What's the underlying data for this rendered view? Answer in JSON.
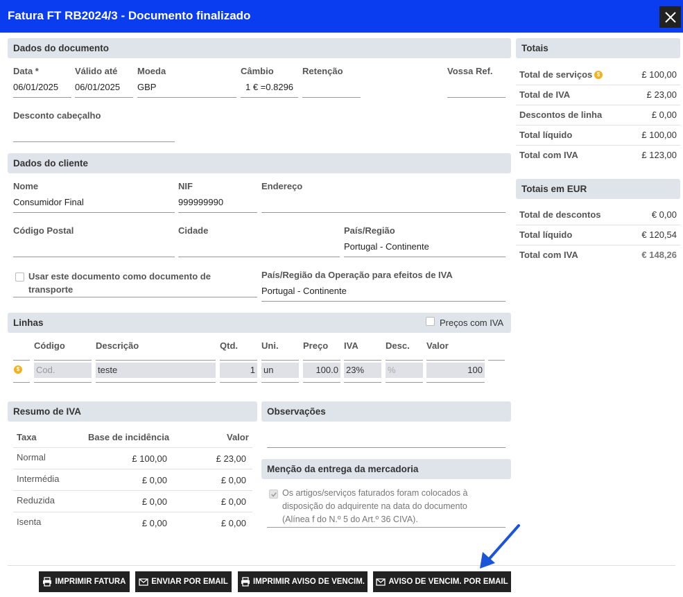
{
  "window": {
    "title": "Fatura FT RB2024/3 - Documento finalizado"
  },
  "document": {
    "section": "Dados do documento",
    "data_label": "Data *",
    "data_value": "06/01/2025",
    "valido_label": "Válido até",
    "valido_value": "06/01/2025",
    "moeda_label": "Moeda",
    "moeda_value": "GBP",
    "cambio_label": "Câmbio",
    "cambio_value": "1 € =0.8296",
    "retencao_label": "Retenção",
    "retencao_value": "",
    "vossa_ref_label": "Vossa Ref.",
    "vossa_ref_value": "",
    "desconto_label": "Desconto cabeçalho",
    "desconto_value": ""
  },
  "client": {
    "section": "Dados do cliente",
    "nome_label": "Nome",
    "nome_value": "Consumidor Final",
    "nif_label": "NIF",
    "nif_value": "999999990",
    "endereco_label": "Endereço",
    "endereco_value": "",
    "codigo_postal_label": "Código Postal",
    "codigo_postal_value": "",
    "cidade_label": "Cidade",
    "cidade_value": "",
    "pais_label": "País/Região",
    "pais_value": "Portugal - Continente",
    "transporte_label": "Usar este documento como documento de transporte",
    "pais_iva_label": "País/Região da Operação para efeitos de IVA",
    "pais_iva_value": "Portugal - Continente"
  },
  "lines": {
    "section": "Linhas",
    "precos_iva_label": "Preços com IVA",
    "headers": {
      "codigo": "Código",
      "descricao": "Descrição",
      "qtd": "Qtd.",
      "uni": "Uni.",
      "preco": "Preço",
      "iva": "IVA",
      "desc": "Desc.",
      "valor": "Valor"
    },
    "rows": [
      {
        "icon": "$",
        "codigo": "Cod.",
        "descricao": "teste",
        "qtd": "1",
        "uni": "un",
        "preco": "100.0",
        "iva": "23%",
        "desc": "%",
        "valor": "100"
      }
    ]
  },
  "vat_summary": {
    "section": "Resumo de IVA",
    "headers": {
      "taxa": "Taxa",
      "base": "Base de incidência",
      "valor": "Valor"
    },
    "rows": [
      {
        "taxa": "Normal",
        "base": "£ 100,00",
        "valor": "£ 23,00"
      },
      {
        "taxa": "Intermédia",
        "base": "£ 0,00",
        "valor": "£ 0,00"
      },
      {
        "taxa": "Reduzida",
        "base": "£ 0,00",
        "valor": "£ 0,00"
      },
      {
        "taxa": "Isenta",
        "base": "£ 0,00",
        "valor": "£ 0,00"
      }
    ]
  },
  "observacoes": {
    "section": "Observações",
    "value": ""
  },
  "entrega": {
    "section": "Menção da entrega da mercadoria",
    "text": "Os artigos/serviços faturados foram colocados à disposição do adquirente na data do documento (Alínea f do N.º 5 do Art.º 36 CIVA)."
  },
  "totals": {
    "section": "Totais",
    "rows": [
      {
        "label": "Total de serviços",
        "value": "£ 100,00"
      },
      {
        "label": "Total de IVA",
        "value": "£ 23,00"
      },
      {
        "label": "Descontos de linha",
        "value": "£ 0,00"
      },
      {
        "label": "Total líquido",
        "value": "£ 100,00"
      },
      {
        "label": "Total com IVA",
        "value": "£ 123,00"
      }
    ]
  },
  "totals_eur": {
    "section": "Totais em EUR",
    "rows": [
      {
        "label": "Total de descontos",
        "value": "€ 0,00"
      },
      {
        "label": "Total líquido",
        "value": "€ 120,54"
      },
      {
        "label": "Total com IVA",
        "value": "€ 148,26"
      }
    ]
  },
  "buttons": {
    "imprimir_fatura": "IMPRIMIR FATURA",
    "enviar_email": "ENVIAR POR EMAIL",
    "imprimir_aviso": "IMPRIMIR AVISO DE VENCIM.",
    "aviso_email": "AVISO DE VENCIM. POR EMAIL"
  },
  "colors": {
    "titlebar": "#0b3df0",
    "section_bg": "#dfe3ea",
    "button_bg": "#222222",
    "arrow": "#1a55d8",
    "coin": "#f3b21b"
  }
}
